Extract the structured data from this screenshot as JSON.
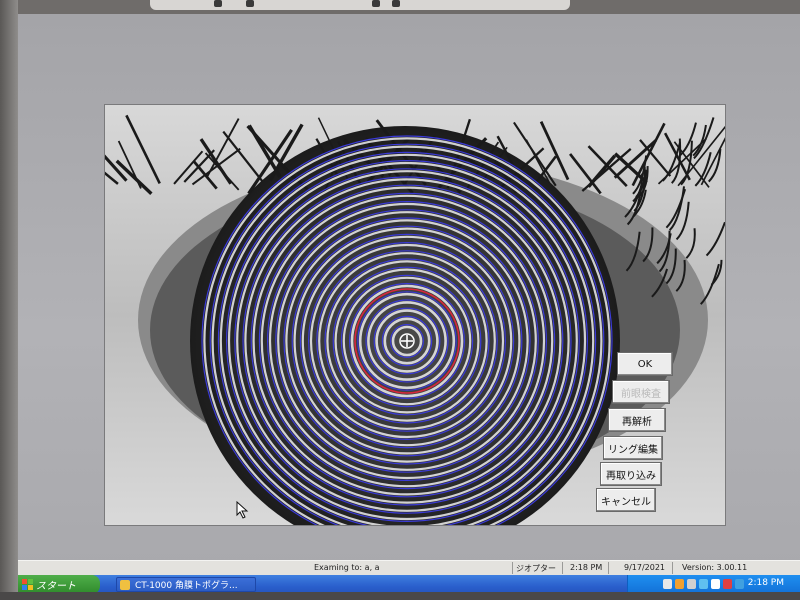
{
  "dialog": {
    "buttons": [
      {
        "label": "OK",
        "enabled": true
      },
      {
        "label": "前眼検査",
        "enabled": false
      },
      {
        "label": "再解析",
        "enabled": true
      },
      {
        "label": "リング編集",
        "enabled": true
      },
      {
        "label": "再取り込み",
        "enabled": true
      },
      {
        "label": "キャンセル",
        "enabled": true
      }
    ]
  },
  "status_bar": {
    "examining": "Examing to: a, a",
    "mode": "ジオプター",
    "time": "2:18 PM",
    "date": "9/17/2021",
    "version": "Version: 3.00.11"
  },
  "taskbar": {
    "start_label": "スタート",
    "task_label": "CT-1000 角膜トポグラ...",
    "tray_time": "2:18 PM"
  },
  "colors": {
    "ring_overlay": "#3a3ad8",
    "center_ring": "#d8283a",
    "taskbar": "#2a5fcc",
    "start_button": "#2f8a2b"
  }
}
